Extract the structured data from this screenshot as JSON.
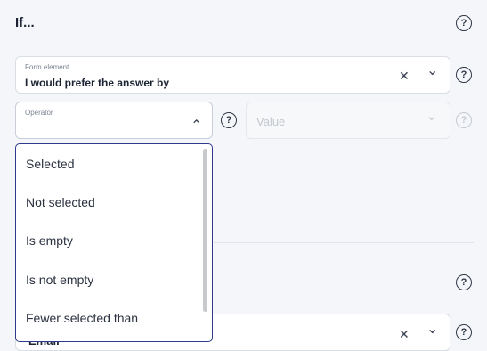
{
  "header": {
    "title": "If..."
  },
  "form_element": {
    "label": "Form element",
    "value": "I would prefer the answer by",
    "clear_glyph": "✕",
    "chevron_glyph": "⌄"
  },
  "operator": {
    "label": "Operator",
    "value": "",
    "chevron_glyph": "⌃"
  },
  "value_field": {
    "placeholder": "Value",
    "chevron_glyph": "⌄"
  },
  "help_glyph": "?",
  "dropdown": {
    "options": [
      {
        "label": "Selected"
      },
      {
        "label": "Not selected"
      },
      {
        "label": "Is empty"
      },
      {
        "label": "Is not empty"
      },
      {
        "label": "Fewer selected than"
      }
    ]
  },
  "second_form_element": {
    "value": "Email",
    "clear_glyph": "✕",
    "chevron_glyph": "⌄"
  },
  "colors": {
    "background": "#f5f6f9",
    "accent": "#2f3a8c",
    "text": "#1c2434"
  }
}
